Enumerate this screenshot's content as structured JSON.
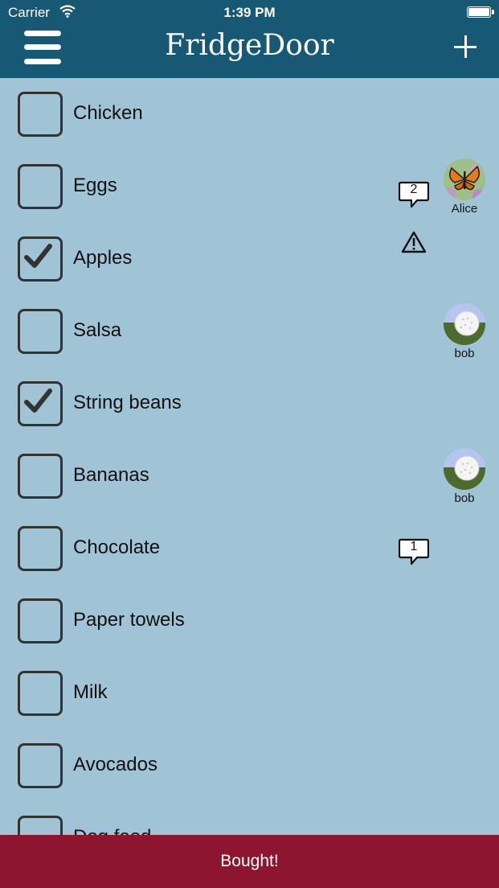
{
  "status": {
    "carrier": "Carrier",
    "time": "1:39 PM"
  },
  "header": {
    "title": "FridgeDoor"
  },
  "items": [
    {
      "label": "Chicken",
      "checked": false
    },
    {
      "label": "Eggs",
      "checked": false,
      "user": "Alice",
      "avatar_icon": "butterfly-avatar-icon",
      "comments": "2"
    },
    {
      "label": "Apples",
      "checked": true,
      "warning_icon": "warning-icon"
    },
    {
      "label": "Salsa",
      "checked": false,
      "user": "bob",
      "avatar_icon": "golf-ball-avatar-icon"
    },
    {
      "label": "String beans",
      "checked": true
    },
    {
      "label": "Bananas",
      "checked": false,
      "user": "bob",
      "avatar_icon": "golf-ball-avatar-icon"
    },
    {
      "label": "Chocolate",
      "checked": false,
      "comments": "1"
    },
    {
      "label": "Paper towels",
      "checked": false
    },
    {
      "label": "Milk",
      "checked": false
    },
    {
      "label": "Avocados",
      "checked": false
    },
    {
      "label": "Dog food",
      "checked": false
    }
  ],
  "footer": {
    "button_label": "Bought!"
  },
  "colors": {
    "header_bg": "#175874",
    "list_bg": "#a0c4d6",
    "footer_bg": "#8e1530"
  }
}
